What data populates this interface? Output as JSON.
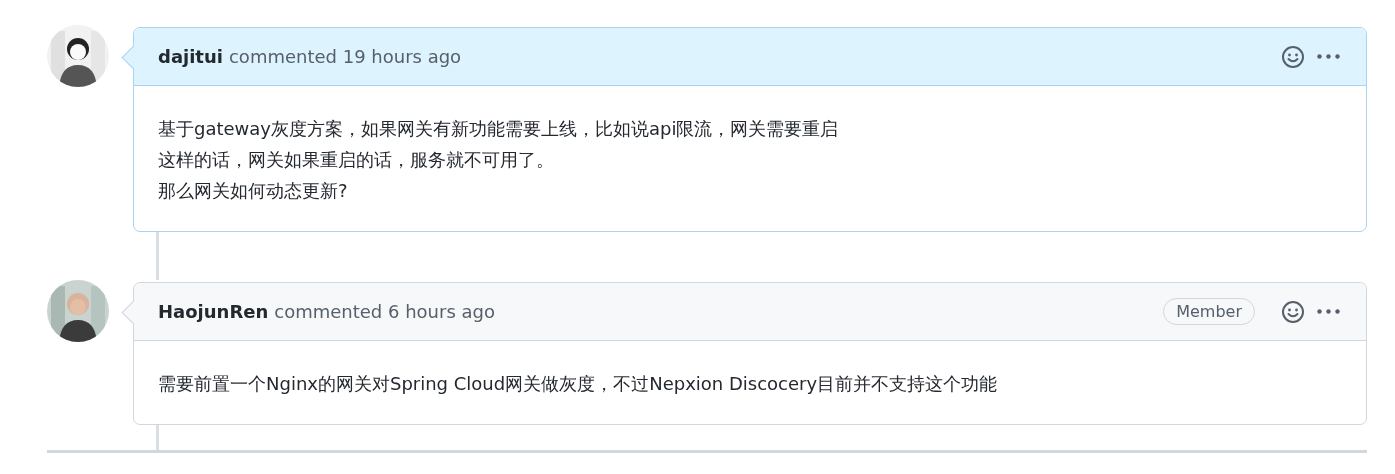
{
  "comments": [
    {
      "author": "dajitui",
      "action": "commented 19 hours ago",
      "highlighted": true,
      "body": [
        "基于gateway灰度方案，如果网关有新功能需要上线，比如说api限流，网关需要重启",
        "这样的话，网关如果重启的话，服务就不可用了。",
        "那么网关如何动态更新?"
      ]
    },
    {
      "author": "HaojunRen",
      "action": "commented 6 hours ago",
      "highlighted": false,
      "badge": "Member",
      "body": [
        "需要前置一个Nginx的网关对Spring Cloud网关做灰度，不过Nepxion Discocery目前并不支持这个功能"
      ]
    }
  ]
}
